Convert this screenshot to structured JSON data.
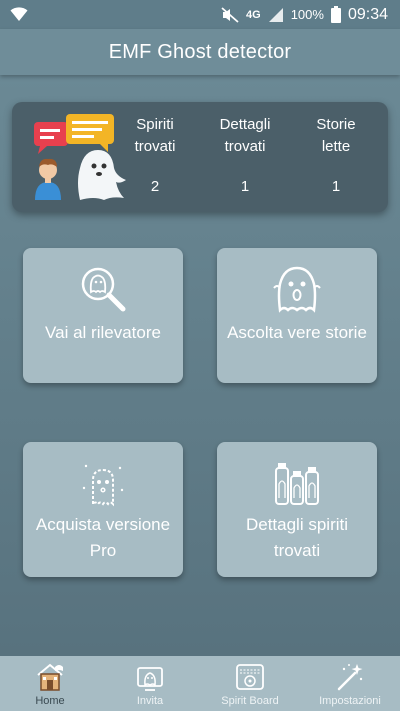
{
  "status_bar": {
    "battery": "100%",
    "time": "09:34",
    "network": "4G"
  },
  "app_bar": {
    "title": "EMF Ghost detector"
  },
  "stats": [
    {
      "label": "Spiriti trovati",
      "value": "2"
    },
    {
      "label": "Dettagli trovati",
      "value": "1"
    },
    {
      "label": "Storie lette",
      "value": "1"
    }
  ],
  "tiles": [
    {
      "label": "Vai al rilevatore",
      "icon": "magnifier-ghost-icon"
    },
    {
      "label": "Ascolta vere storie",
      "icon": "scared-ghost-icon"
    },
    {
      "label": "Acquista versione Pro",
      "icon": "ghost-icon"
    },
    {
      "label": "Dettagli spiriti trovati",
      "icon": "ghost-jars-icon"
    }
  ],
  "bottom_nav": [
    {
      "label": "Home",
      "icon": "house-icon",
      "active": true
    },
    {
      "label": "Invita",
      "icon": "invite-ghost-icon",
      "active": false
    },
    {
      "label": "Spirit Board",
      "icon": "spirit-board-icon",
      "active": false
    },
    {
      "label": "Impostazioni",
      "icon": "magic-wand-icon",
      "active": false
    }
  ],
  "colors": {
    "background": "#637f8b",
    "card": "#4b5f69",
    "tile": "#a7bcc4",
    "app_bar": "#6f8d99",
    "speech_red": "#e8404e",
    "speech_yellow": "#f3b526"
  }
}
